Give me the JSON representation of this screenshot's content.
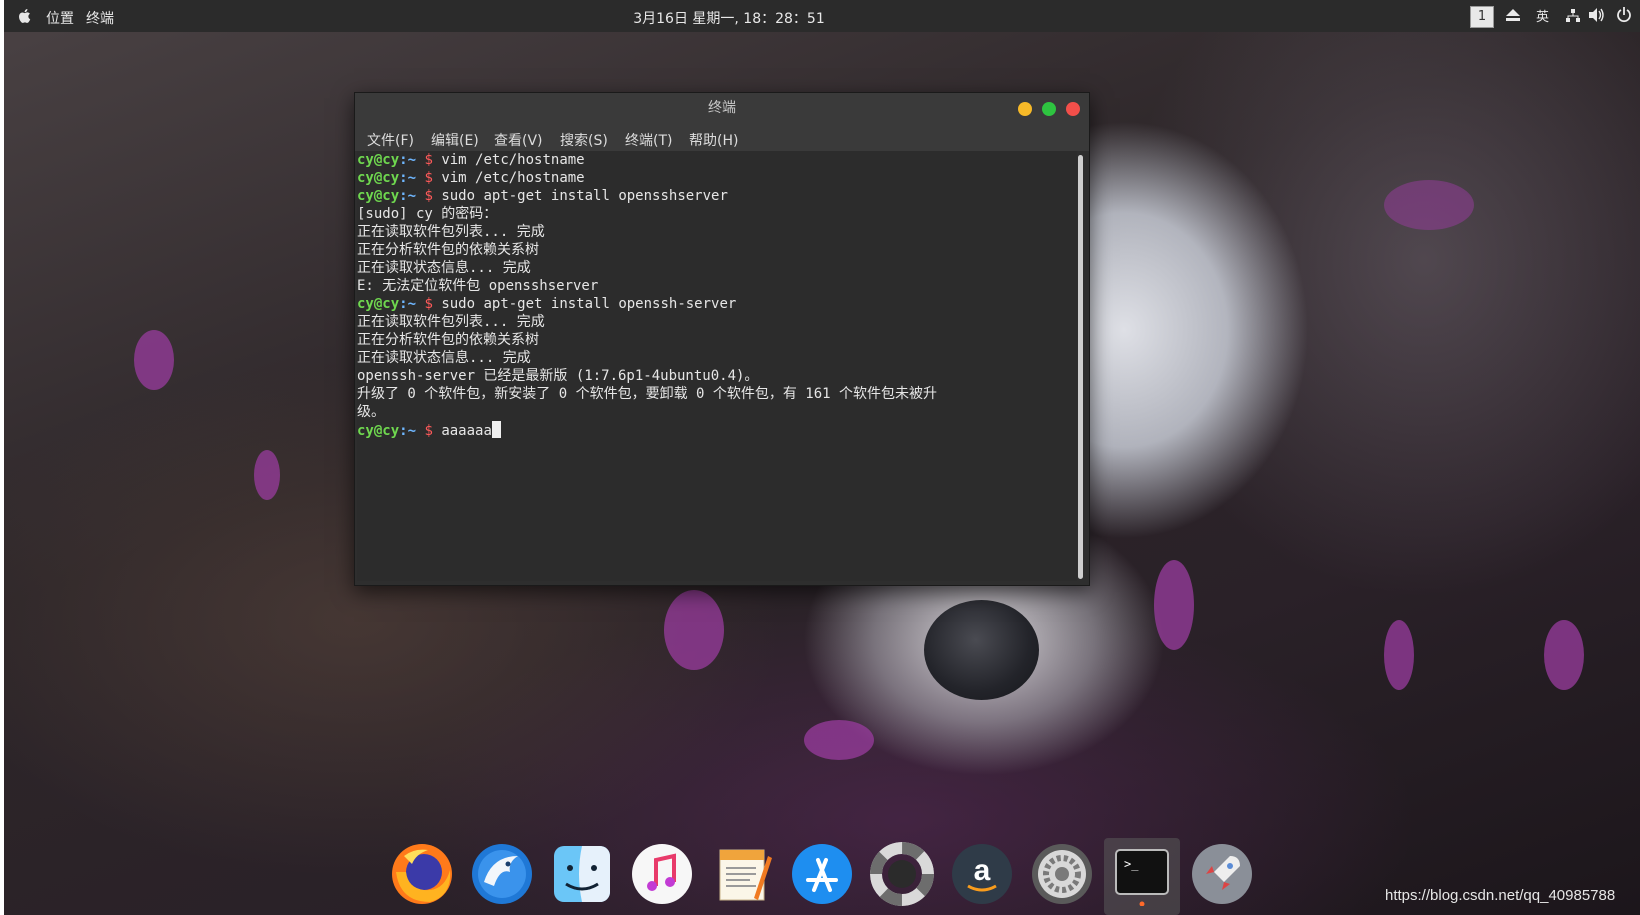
{
  "topbar": {
    "app_menu": [
      "位置",
      "终端"
    ],
    "clock": "3月16日 星期一, 18：28：51",
    "workspace": "1",
    "input_method": "英",
    "tray_icons": [
      "eject-icon",
      "network-icon",
      "volume-icon",
      "power-icon"
    ]
  },
  "terminal": {
    "title": "终端",
    "menu": [
      "文件(F)",
      "编辑(E)",
      "查看(V)",
      "搜索(S)",
      "终端(T)",
      "帮助(H)"
    ],
    "prompt": {
      "user": "cy@cy",
      "path": ":~",
      "symbol": "$"
    },
    "lines": [
      {
        "type": "cmd",
        "text": " vim /etc/hostname"
      },
      {
        "type": "cmd",
        "text": " vim /etc/hostname"
      },
      {
        "type": "cmd",
        "text": " sudo apt-get install opensshserver"
      },
      {
        "type": "out",
        "text": "[sudo] cy 的密码："
      },
      {
        "type": "out",
        "text": "正在读取软件包列表... 完成"
      },
      {
        "type": "out",
        "text": "正在分析软件包的依赖关系树"
      },
      {
        "type": "out",
        "text": "正在读取状态信息... 完成"
      },
      {
        "type": "out",
        "text": "E: 无法定位软件包 opensshserver"
      },
      {
        "type": "cmd",
        "text": " sudo apt-get install openssh-server"
      },
      {
        "type": "out",
        "text": "正在读取软件包列表... 完成"
      },
      {
        "type": "out",
        "text": "正在分析软件包的依赖关系树"
      },
      {
        "type": "out",
        "text": "正在读取状态信息... 完成"
      },
      {
        "type": "out",
        "text": "openssh-server 已经是最新版 (1:7.6p1-4ubuntu0.4)。"
      },
      {
        "type": "out",
        "text": "升级了 0 个软件包，新安装了 0 个软件包，要卸载 0 个软件包，有 161 个软件包未被升"
      },
      {
        "type": "out",
        "text": "级。"
      },
      {
        "type": "cmd",
        "text": " aaaaaa",
        "cursor": true
      }
    ]
  },
  "dock": {
    "items": [
      "firefox-icon",
      "browser-eagle-icon",
      "finder-icon",
      "music-icon",
      "pages-icon",
      "app-store-icon",
      "help-lifebuoy-icon",
      "amazon-icon",
      "settings-gear-icon",
      "terminal-icon",
      "launchpad-rocket-icon"
    ],
    "active": "terminal-icon"
  },
  "watermark": "https://blog.csdn.net/qq_40985788",
  "colors": {
    "topbar_bg": "#2b2b2b",
    "terminal_bg": "#2c2c2c",
    "prompt_user": "#6fd84f",
    "prompt_path": "#6fb7ff",
    "prompt_dollar": "#ff5a5a",
    "close": "#f24f4a",
    "minimize": "#f7b928",
    "maximize": "#2ec440"
  }
}
